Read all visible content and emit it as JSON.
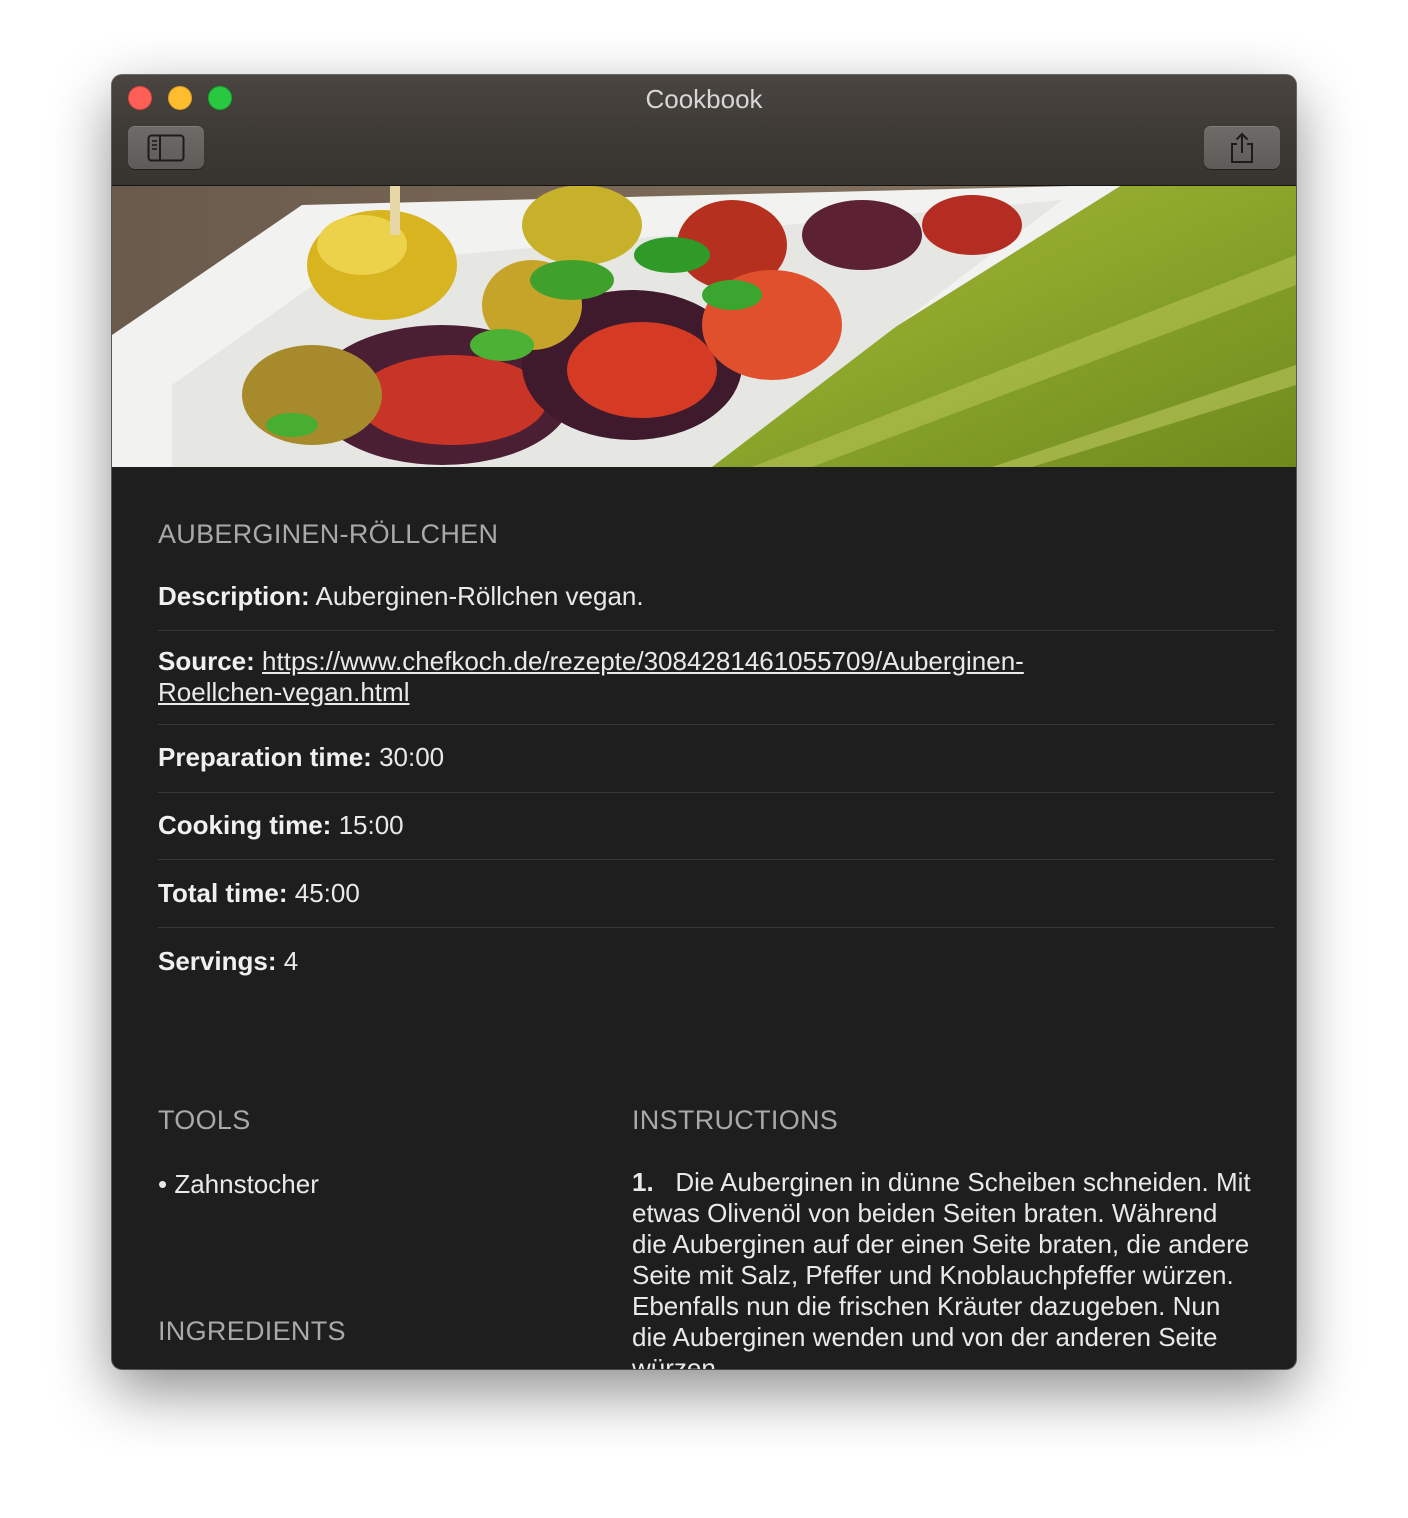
{
  "window": {
    "title": "Cookbook"
  },
  "toolbar": {
    "sidebar_icon": "sidebar-toggle-icon",
    "share_icon": "share-icon"
  },
  "recipe": {
    "name": "AUBERGINEN-RÖLLCHEN",
    "description_label": "Description:",
    "description_value": "Auberginen-Röllchen vegan.",
    "source_label": "Source:",
    "source_line1": "https://www.chefkoch.de/rezepte/3084281461055709/Auberginen-",
    "source_line2": "Roellchen-vegan.html",
    "prep_label": "Preparation time:",
    "prep_value": "30:00",
    "cook_label": "Cooking time:",
    "cook_value": "15:00",
    "total_label": "Total time:",
    "total_value": "45:00",
    "servings_label": "Servings:",
    "servings_value": "4"
  },
  "tools": {
    "title": "TOOLS",
    "items": [
      "• Zahnstocher"
    ]
  },
  "ingredients": {
    "title": "INGREDIENTS"
  },
  "instructions": {
    "title": "INSTRUCTIONS",
    "steps": [
      {
        "number": "1.",
        "text": "Die Auberginen in dünne Scheiben schneiden. Mit etwas Olivenöl von beiden Seiten braten. Während die Auberginen auf der einen Seite braten, die andere Seite mit Salz, Pfeffer und Knoblauchpfeffer würzen. Ebenfalls nun die frischen Kräuter dazugeben. Nun die Auberginen wenden und von der anderen Seite würzen."
      }
    ]
  }
}
